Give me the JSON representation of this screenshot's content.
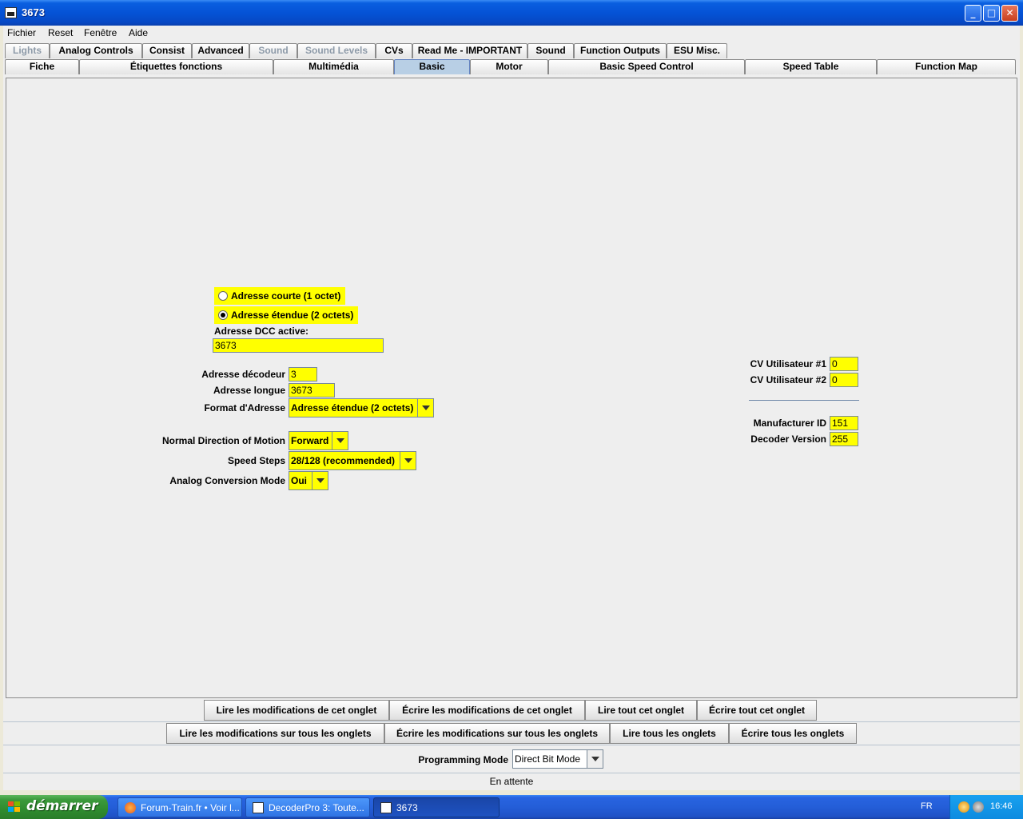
{
  "window": {
    "title": "3673"
  },
  "menu": [
    "Fichier",
    "Reset",
    "Fenêtre",
    "Aide"
  ],
  "tabs_row1": [
    {
      "label": "Lights",
      "disabled": true
    },
    {
      "label": "Analog Controls"
    },
    {
      "label": "Consist"
    },
    {
      "label": "Advanced"
    },
    {
      "label": "Sound",
      "disabled": true
    },
    {
      "label": "Sound Levels",
      "disabled": true
    },
    {
      "label": "CVs"
    },
    {
      "label": "Read Me - IMPORTANT"
    },
    {
      "label": "Sound"
    },
    {
      "label": "Function Outputs"
    },
    {
      "label": "ESU Misc."
    }
  ],
  "tabs_row2": [
    {
      "label": "Fiche"
    },
    {
      "label": "Étiquettes fonctions"
    },
    {
      "label": "Multimédia"
    },
    {
      "label": "Basic",
      "active": true
    },
    {
      "label": "Motor"
    },
    {
      "label": "Basic Speed Control"
    },
    {
      "label": "Speed Table"
    },
    {
      "label": "Function Map"
    }
  ],
  "basic": {
    "radio_short": "Adresse courte (1 octet)",
    "radio_extended": "Adresse étendue (2 octets)",
    "active_dcc_label": "Adresse DCC active:",
    "active_dcc_value": "3673",
    "decoder_address_label": "Adresse décodeur",
    "decoder_address_value": "3",
    "long_address_label": "Adresse longue",
    "long_address_value": "3673",
    "address_format_label": "Format d'Adresse",
    "address_format_value": "Adresse étendue (2 octets)",
    "direction_label": "Normal Direction of Motion",
    "direction_value": "Forward",
    "speed_steps_label": "Speed Steps",
    "speed_steps_value": "28/128 (recommended)",
    "analog_label": "Analog Conversion Mode",
    "analog_value": "Oui",
    "cv_user1_label": "CV Utilisateur #1",
    "cv_user1_value": "0",
    "cv_user2_label": "CV Utilisateur #2",
    "cv_user2_value": "0",
    "manufacturer_label": "Manufacturer ID",
    "manufacturer_value": "151",
    "decoder_version_label": "Decoder Version",
    "decoder_version_value": "255"
  },
  "tab_buttons": {
    "read_changes": "Lire les modifications de cet onglet",
    "write_changes": "Écrire les modifications de cet onglet",
    "read_all": "Lire tout cet onglet",
    "write_all": "Écrire tout cet onglet"
  },
  "all_buttons": {
    "read_changes": "Lire les modifications sur tous les onglets",
    "write_changes": "Écrire les modifications sur tous les onglets",
    "read_all": "Lire tous les onglets",
    "write_all": "Écrire tous les onglets"
  },
  "programming": {
    "label": "Programming Mode",
    "value": "Direct Bit Mode"
  },
  "status": "En attente",
  "taskbar": {
    "start": "démarrer",
    "tasks": [
      "Forum-Train.fr • Voir l...",
      "DecoderPro 3: Toute...",
      "3673"
    ],
    "lang": "FR",
    "clock": "16:46"
  }
}
